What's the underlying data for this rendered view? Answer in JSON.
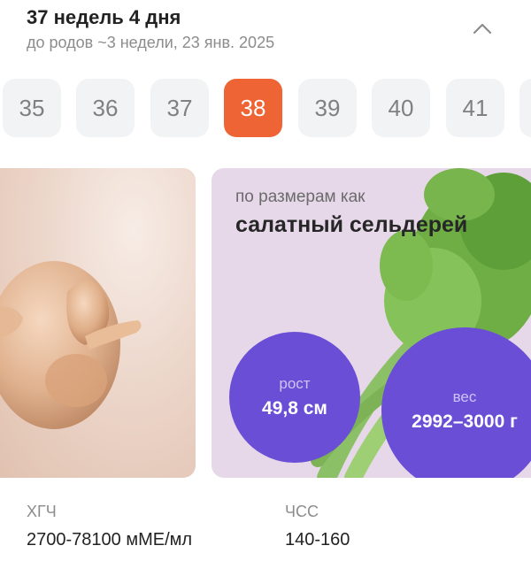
{
  "header": {
    "title": "37 недель 4 дня",
    "subtitle": "до родов ~3 недели, 23 янв. 2025"
  },
  "weeks": [
    "35",
    "36",
    "37",
    "38",
    "39",
    "40",
    "41"
  ],
  "selected_week": "38",
  "size_card": {
    "label": "по размерам как",
    "fruit": "салатный сельдерей",
    "height_label": "рост",
    "height_value": "49,8 см",
    "weight_label": "вес",
    "weight_value": "2992–3000 г"
  },
  "metrics": {
    "hcg_label": "ХГЧ",
    "hcg_value": "2700-78100 мМЕ/мл",
    "hr_label": "ЧСС",
    "hr_value": "140-160"
  },
  "icons": {
    "collapse": "chevron-up-icon"
  },
  "colors": {
    "accent": "#ee6434",
    "bubble": "#6a4fd6",
    "card_bg": "#e6d8e9"
  }
}
